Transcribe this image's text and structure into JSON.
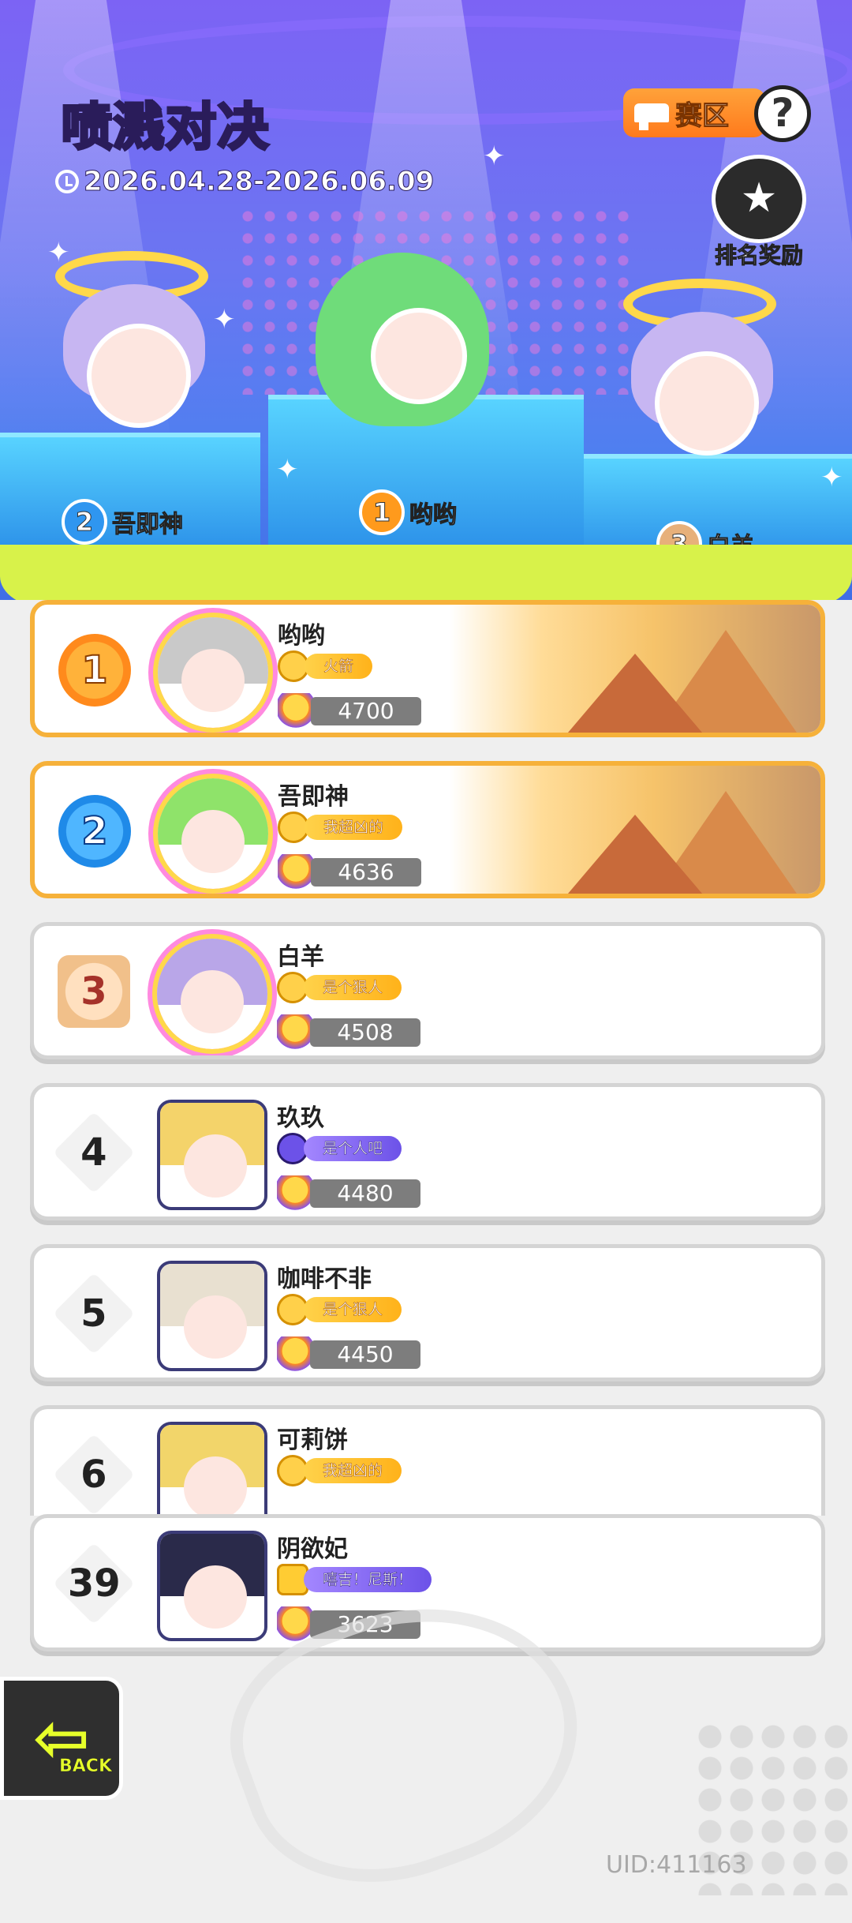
{
  "header": {
    "title_highlight": "喷溅",
    "title_rest": "对决",
    "date_range": "2026.04.28-2026.06.09",
    "zone_label": "赛区",
    "help_label": "?",
    "reward_label": "排名奖励"
  },
  "podium": [
    {
      "rank": "2",
      "name": "吾即神",
      "color": "#2f96f0"
    },
    {
      "rank": "1",
      "name": "哟哟",
      "color": "#ff9a1c"
    },
    {
      "rank": "3",
      "name": "白羊",
      "color": "#e7b07a"
    }
  ],
  "leaderboard": [
    {
      "rank": "1",
      "name": "哟哟",
      "title": "火箭",
      "title_style": "orange",
      "score": "4700",
      "highlight": true
    },
    {
      "rank": "2",
      "name": "吾即神",
      "title": "我超凶的",
      "title_style": "orange",
      "score": "4636",
      "highlight": true
    },
    {
      "rank": "3",
      "name": "白羊",
      "title": "是个狠人",
      "title_style": "orange",
      "score": "4508",
      "highlight": false
    },
    {
      "rank": "4",
      "name": "玖玖",
      "title": "是个人吧",
      "title_style": "purple",
      "score": "4480",
      "highlight": false
    },
    {
      "rank": "5",
      "name": "咖啡不非",
      "title": "是个狠人",
      "title_style": "orange",
      "score": "4450",
      "highlight": false
    },
    {
      "rank": "6",
      "name": "可莉饼",
      "title": "我超凶的",
      "title_style": "orange",
      "score": "",
      "highlight": false
    }
  ],
  "self_entry": {
    "rank": "39",
    "name": "阴欲妃",
    "title": "嘻吉！尼斯！",
    "title_style": "purple",
    "score": "3623"
  },
  "back_label": "BACK",
  "uid": "UID:411163"
}
